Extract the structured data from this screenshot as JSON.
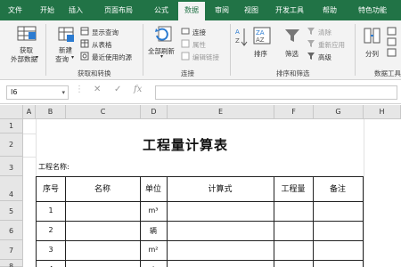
{
  "ribbon_tabs": [
    "文件",
    "开始",
    "插入",
    "页面布局",
    "公式",
    "数据",
    "审阅",
    "视图",
    "开发工具",
    "帮助",
    "特色功能"
  ],
  "active_tab": "数据",
  "ribbon": {
    "get_external": [
      "获取",
      "外部数据"
    ],
    "new_query": [
      "新建",
      "查询"
    ],
    "show_queries": "显示查询",
    "from_table": "从表格",
    "recent_sources": "最近使用的源",
    "group_get_transform": "获取和转换",
    "refresh_all": "全部刷新",
    "connections": "连接",
    "properties": "属性",
    "edit_links": "编辑链接",
    "group_connections": "连接",
    "sort": "排序",
    "filter": "筛选",
    "clear": "清除",
    "reapply": "重新应用",
    "advanced": "高级",
    "group_sort_filter": "排序和筛选",
    "text_to_columns": "分列",
    "group_data_tools": "数据工具"
  },
  "formula_bar": {
    "name_box": "I6",
    "fx": "fx",
    "cancel": "✕",
    "enter": "✓"
  },
  "columns": [
    "A",
    "B",
    "C",
    "D",
    "E",
    "F",
    "G",
    "H"
  ],
  "rows": [
    "1",
    "2",
    "3",
    "4",
    "5",
    "6",
    "7",
    "8"
  ],
  "sheet": {
    "title": "工程量计算表",
    "project_label": "工程名称:",
    "headers": [
      "序号",
      "名称",
      "单位",
      "计算式",
      "工程量",
      "备注"
    ],
    "data_rows": [
      {
        "no": "1",
        "unit": "m³"
      },
      {
        "no": "2",
        "unit": "辆"
      },
      {
        "no": "3",
        "unit": "m²"
      },
      {
        "no": "4",
        "unit": "个"
      }
    ]
  },
  "colors": {
    "ribbon_green": "#217346"
  }
}
